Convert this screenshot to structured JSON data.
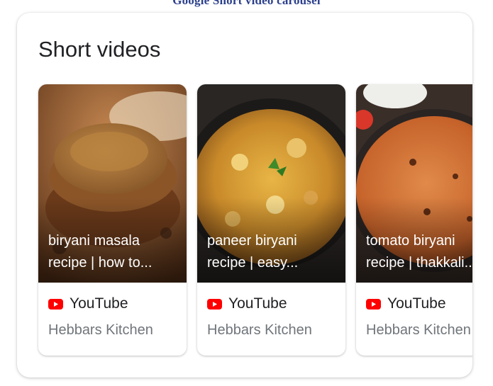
{
  "header_caption": "Google Short video carousel",
  "panel": {
    "title": "Short videos"
  },
  "cards": [
    {
      "title_line1": "biryani masala",
      "title_line2": "recipe | how to...",
      "source": "YouTube",
      "source_icon": "youtube-icon",
      "channel": "Hebbars Kitchen"
    },
    {
      "title_line1": "paneer biryani",
      "title_line2": "recipe | easy...",
      "source": "YouTube",
      "source_icon": "youtube-icon",
      "channel": "Hebbars Kitchen"
    },
    {
      "title_line1": "tomato biryani",
      "title_line2": "recipe | thakkali...",
      "source": "YouTube",
      "source_icon": "youtube-icon",
      "channel": "Hebbars Kitchen"
    }
  ],
  "colors": {
    "youtube_red": "#ff0000",
    "text_primary": "#202124",
    "text_secondary": "#70757a"
  }
}
